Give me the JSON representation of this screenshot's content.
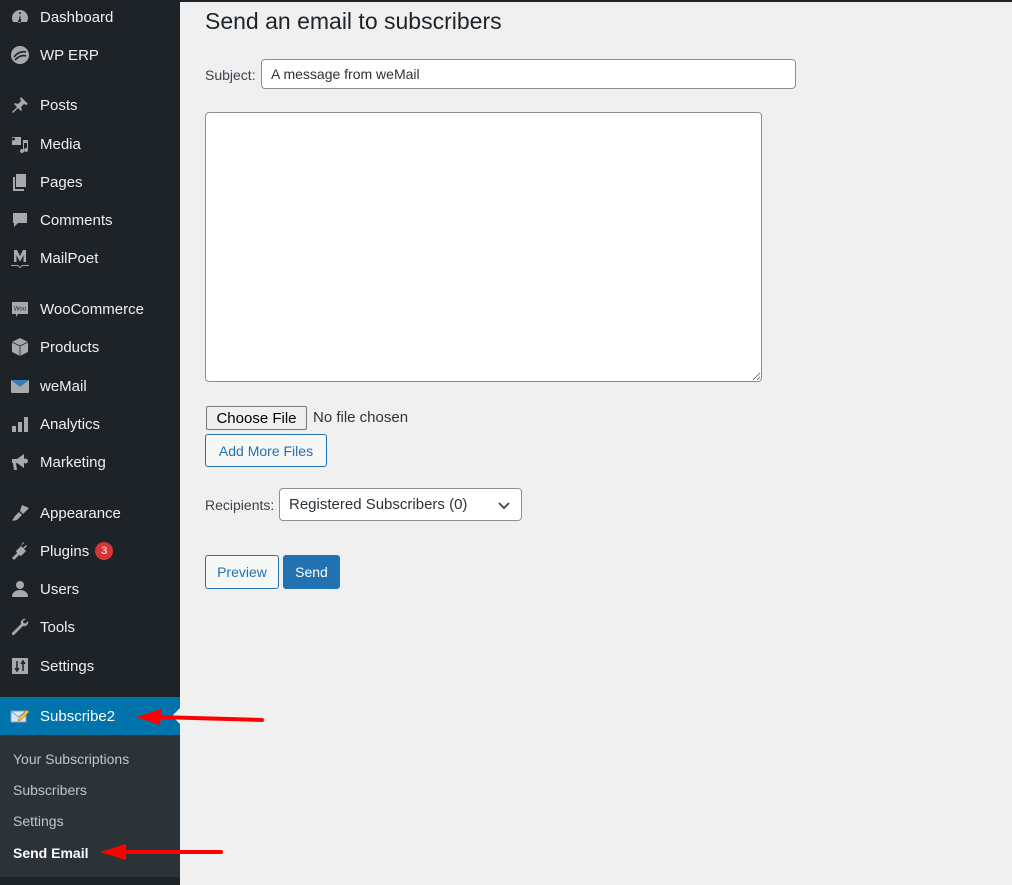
{
  "sidebar": {
    "items": [
      {
        "label": "Dashboard",
        "icon": "dashboard-icon"
      },
      {
        "label": "WP ERP",
        "icon": "wp-erp-icon"
      },
      {
        "label": "Posts",
        "icon": "pushpin-icon"
      },
      {
        "label": "Media",
        "icon": "media-icon"
      },
      {
        "label": "Pages",
        "icon": "pages-icon"
      },
      {
        "label": "Comments",
        "icon": "comment-icon"
      },
      {
        "label": "MailPoet",
        "icon": "mailpoet-icon"
      },
      {
        "label": "WooCommerce",
        "icon": "woo-icon"
      },
      {
        "label": "Products",
        "icon": "box-icon"
      },
      {
        "label": "weMail",
        "icon": "envelope-icon"
      },
      {
        "label": "Analytics",
        "icon": "bar-chart-icon"
      },
      {
        "label": "Marketing",
        "icon": "megaphone-icon"
      },
      {
        "label": "Appearance",
        "icon": "paintbrush-icon"
      },
      {
        "label": "Plugins",
        "icon": "plug-icon",
        "badge": "3"
      },
      {
        "label": "Users",
        "icon": "user-icon"
      },
      {
        "label": "Tools",
        "icon": "wrench-icon"
      },
      {
        "label": "Settings",
        "icon": "sliders-icon"
      },
      {
        "label": "Subscribe2",
        "icon": "subscribe2-icon",
        "active": true
      }
    ],
    "submenu": [
      {
        "label": "Your Subscriptions"
      },
      {
        "label": "Subscribers"
      },
      {
        "label": "Settings"
      },
      {
        "label": "Send Email",
        "current": true
      }
    ]
  },
  "main": {
    "title": "Send an email to subscribers",
    "subject_label": "Subject:",
    "subject_value": "A message from weMail",
    "body_value": "",
    "choose_file_label": "Choose File",
    "no_file_text": "No file chosen",
    "add_more_files_label": "Add More Files",
    "recipients_label": "Recipients:",
    "recipients_selected": "Registered Subscribers (0)",
    "preview_label": "Preview",
    "send_label": "Send"
  },
  "colors": {
    "sidebar_bg": "#1d2327",
    "active_bg": "#0073aa",
    "accent": "#2271b1",
    "badge": "#d63638",
    "annotation_arrow": "#ff0000"
  }
}
